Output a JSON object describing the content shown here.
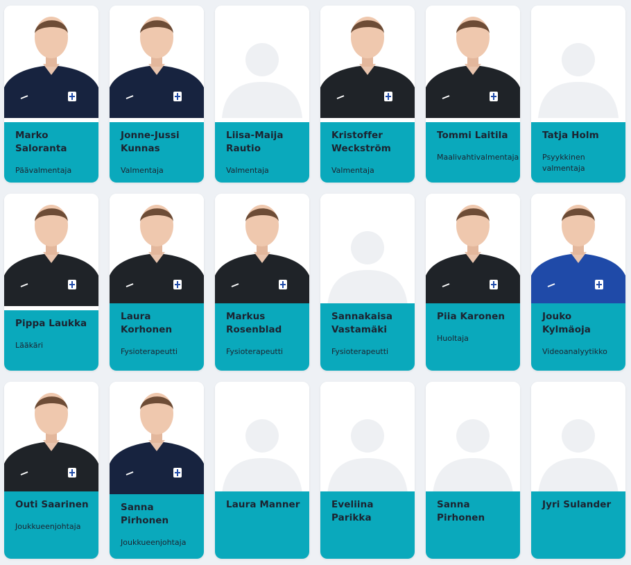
{
  "colors": {
    "accent": "#0aa9bc",
    "jersey_dark": "#1f2328",
    "jersey_navy": "#17233f",
    "placeholder": "#eef0f3"
  },
  "staff": [
    {
      "name": "Marko Saloranta",
      "role": "Päävalmentaja",
      "photo": "navy"
    },
    {
      "name": "Jonne-Jussi Kunnas",
      "role": "Valmentaja",
      "photo": "navy"
    },
    {
      "name": "Liisa-Maija Rautio",
      "role": "Valmentaja",
      "photo": "placeholder"
    },
    {
      "name": "Kristoffer Weckström",
      "role": "Valmentaja",
      "photo": "dark"
    },
    {
      "name": "Tommi Laitila",
      "role": "Maalivahtivalmentaja",
      "photo": "dark"
    },
    {
      "name": "Tatja Holm",
      "role": "Psyykkinen valmentaja",
      "photo": "placeholder"
    },
    {
      "name": "Pippa Laukka",
      "role": "Lääkäri",
      "photo": "dark"
    },
    {
      "name": "Laura Korhonen",
      "role": "Fysioterapeutti",
      "photo": "dark"
    },
    {
      "name": "Markus Rosenblad",
      "role": "Fysioterapeutti",
      "photo": "dark"
    },
    {
      "name": "Sannakaisa Vastamäki",
      "role": "Fysioterapeutti",
      "photo": "placeholder"
    },
    {
      "name": "Piia Karonen",
      "role": "Huoltaja",
      "photo": "dark"
    },
    {
      "name": "Jouko Kylmäoja",
      "role": "Videoanalyytikko",
      "photo": "blue"
    },
    {
      "name": "Outi Saarinen",
      "role": "Joukkueenjohtaja",
      "photo": "dark"
    },
    {
      "name": "Sanna Pirhonen",
      "role": "Joukkueenjohtaja",
      "photo": "navy"
    },
    {
      "name": "Laura Manner",
      "role": "",
      "photo": "placeholder"
    },
    {
      "name": "Eveliina Parikka",
      "role": "",
      "photo": "placeholder"
    },
    {
      "name": "Sanna Pirhonen",
      "role": "",
      "photo": "placeholder"
    },
    {
      "name": "Jyri Sulander",
      "role": "",
      "photo": "placeholder"
    }
  ]
}
